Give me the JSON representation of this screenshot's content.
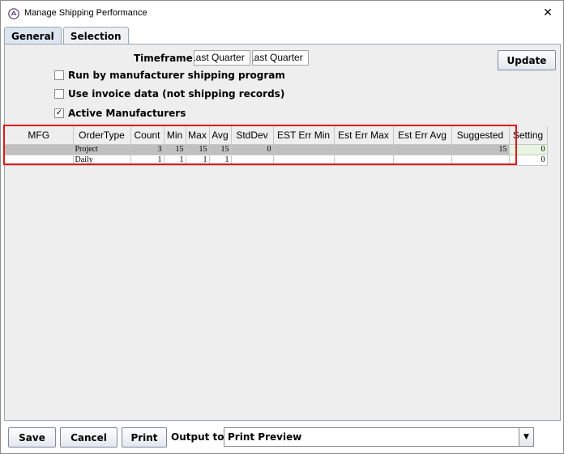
{
  "window": {
    "title": "Manage Shipping Performance",
    "close_glyph": "✕"
  },
  "tabs": [
    {
      "label": "General",
      "active": true
    },
    {
      "label": "Selection",
      "active": false
    }
  ],
  "timeframe": {
    "label": "Timeframe:",
    "value1": "Last Quarter",
    "value2": "Last Quarter"
  },
  "update_label": "Update",
  "options": [
    {
      "label": "Run by manufacturer shipping program",
      "checked": false
    },
    {
      "label": "Use invoice data (not shipping records)",
      "checked": false
    },
    {
      "label": "Active Manufacturers",
      "checked": true
    }
  ],
  "grid": {
    "columns": [
      "MFG",
      "OrderType",
      "Count",
      "Min",
      "Max",
      "Avg",
      "StdDev",
      "EST Err Min",
      "Est Err Max",
      "Est Err Avg",
      "Suggested",
      "Setting"
    ],
    "rows": [
      [
        "",
        "Project",
        "3",
        "15",
        "15",
        "15",
        "0",
        "",
        "",
        "",
        "15",
        "0"
      ],
      [
        "",
        "Daily",
        "1",
        "1",
        "1",
        "1",
        "",
        "",
        "",
        "",
        "",
        "0"
      ]
    ]
  },
  "bottom": {
    "save_label": "Save",
    "cancel_label": "Cancel",
    "print_label": "Print",
    "output_label": "Output to:",
    "output_value": "Print Preview"
  },
  "colors": {
    "highlight": "#e01818",
    "selected_row": "#c0c0c0",
    "setting_cell": "#e6f4e0"
  }
}
